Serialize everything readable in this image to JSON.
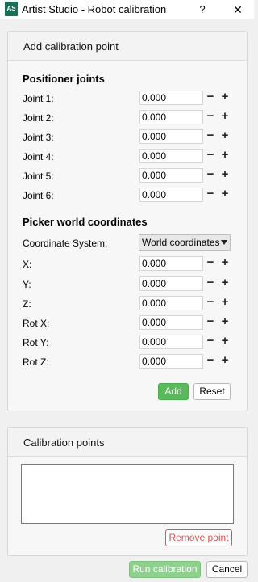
{
  "window": {
    "app_icon_text": "AS",
    "title": "Artist Studio - Robot calibration",
    "help_label": "?",
    "close_label": "✕"
  },
  "add_panel": {
    "title": "Add calibration point",
    "joints_title": "Positioner joints",
    "joints": [
      {
        "label": "Joint 1:",
        "value": "0.000"
      },
      {
        "label": "Joint 2:",
        "value": "0.000"
      },
      {
        "label": "Joint 3:",
        "value": "0.000"
      },
      {
        "label": "Joint 4:",
        "value": "0.000"
      },
      {
        "label": "Joint 5:",
        "value": "0.000"
      },
      {
        "label": "Joint 6:",
        "value": "0.000"
      }
    ],
    "picker_title": "Picker world coordinates",
    "coord_system_label": "Coordinate System:",
    "coord_system_value": "World coordinates",
    "coords": [
      {
        "label": "X:",
        "value": "0.000"
      },
      {
        "label": "Y:",
        "value": "0.000"
      },
      {
        "label": "Z:",
        "value": "0.000"
      },
      {
        "label": "Rot X:",
        "value": "0.000"
      },
      {
        "label": "Rot Y:",
        "value": "0.000"
      },
      {
        "label": "Rot Z:",
        "value": "0.000"
      }
    ],
    "minus_label": "−",
    "plus_label": "+",
    "add_label": "Add",
    "reset_label": "Reset"
  },
  "points_panel": {
    "title": "Calibration points",
    "remove_label": "Remove point"
  },
  "footer": {
    "run_label": "Run calibration",
    "cancel_label": "Cancel"
  },
  "colors": {
    "accent_green": "#5cb85c",
    "danger_red": "#d9534f",
    "app_icon": "#1d6e57"
  }
}
